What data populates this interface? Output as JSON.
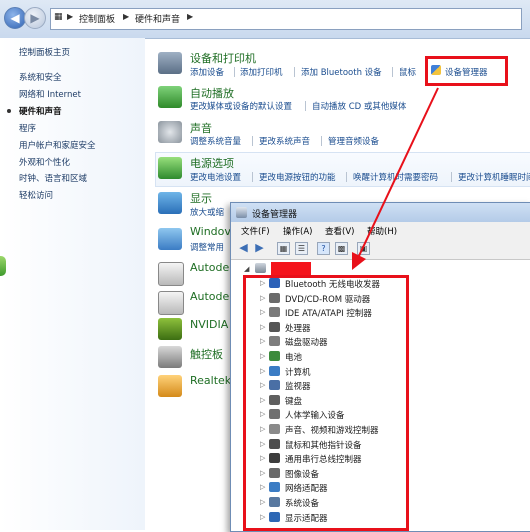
{
  "breadcrumb": [
    "控制面板",
    "硬件和声音"
  ],
  "left_nav": {
    "items": [
      "控制面板主页",
      "系统和安全",
      "网络和 Internet",
      "硬件和声音",
      "程序",
      "用户帐户和家庭安全",
      "外观和个性化",
      "时钟、语言和区域",
      "轻松访问"
    ],
    "current": "硬件和声音"
  },
  "categories": {
    "devices": {
      "title": "设备和打印机",
      "links": [
        "添加设备",
        "添加打印机",
        "添加 Bluetooth 设备",
        "鼠标",
        "设备管理器"
      ]
    },
    "autoplay": {
      "title": "自动播放",
      "links": [
        "更改媒体或设备的默认设置",
        "自动播放 CD 或其他媒体"
      ]
    },
    "sound": {
      "title": "声音",
      "links": [
        "调整系统音量",
        "更改系统声音",
        "管理音频设备"
      ]
    },
    "power": {
      "title": "电源选项",
      "links": [
        "更改电池设置",
        "更改电源按钮的功能",
        "唤醒计算机时需要密码",
        "更改计算机睡眠时间"
      ]
    },
    "display": {
      "title": "显示",
      "links": [
        "放大或缩"
      ]
    },
    "windows": {
      "title": "Windov",
      "links": [
        "调整常用"
      ]
    },
    "autodesk1": {
      "title": "Autode"
    },
    "autodesk2": {
      "title": "Autode"
    },
    "nvidia": {
      "title": "NVIDIA"
    },
    "touchpad": {
      "title": "触控板"
    },
    "realtek": {
      "title": "Realtek"
    }
  },
  "device_manager": {
    "title": "设备管理器",
    "menu": [
      "文件(F)",
      "操作(A)",
      "查看(V)",
      "帮助(H)"
    ],
    "devices": [
      "Bluetooth 无线电收发器",
      "DVD/CD-ROM 驱动器",
      "IDE ATA/ATAPI 控制器",
      "处理器",
      "磁盘驱动器",
      "电池",
      "计算机",
      "监视器",
      "键盘",
      "人体学输入设备",
      "声音、视频和游戏控制器",
      "鼠标和其他指针设备",
      "通用串行总线控制器",
      "图像设备",
      "网络适配器",
      "系统设备",
      "显示适配器"
    ]
  },
  "colors": {
    "annotation_red": "#e8101a",
    "link_blue": "#1b4d8f",
    "title_green": "#1f6e24"
  }
}
